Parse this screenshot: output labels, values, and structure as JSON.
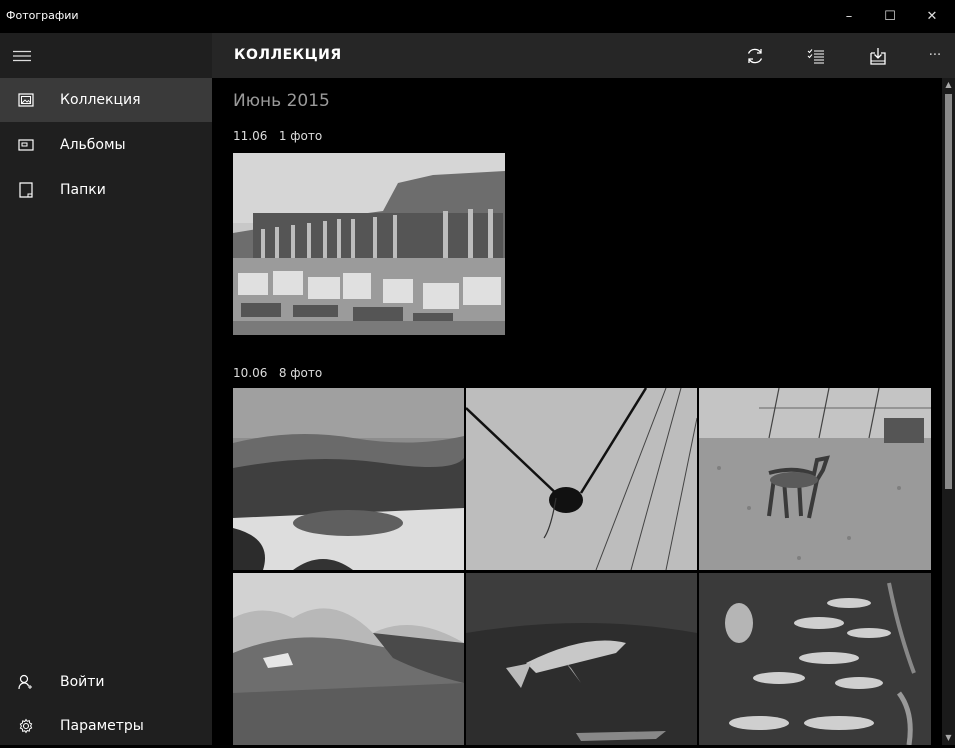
{
  "window": {
    "title": "Фотографии",
    "minimize_glyph": "–",
    "maximize_glyph": "☐",
    "close_glyph": "✕"
  },
  "sidebar": {
    "menu_icon": "hamburger-icon",
    "items": [
      {
        "label": "Коллекция",
        "icon": "collection-icon",
        "selected": true
      },
      {
        "label": "Альбомы",
        "icon": "album-icon",
        "selected": false
      },
      {
        "label": "Папки",
        "icon": "folder-icon",
        "selected": false
      }
    ],
    "bottom_items": [
      {
        "label": "Войти",
        "icon": "person-icon"
      },
      {
        "label": "Параметры",
        "icon": "gear-icon"
      }
    ]
  },
  "header": {
    "title": "КОЛЛЕКЦИЯ",
    "more_glyph": "···",
    "actions": [
      "refresh-icon",
      "select-icon",
      "import-icon",
      "more-icon"
    ]
  },
  "main": {
    "month": "Июнь 2015",
    "groups": [
      {
        "date": "11.06",
        "count": "1 фото"
      },
      {
        "date": "10.06",
        "count": "8 фото"
      }
    ]
  },
  "scrollbar": {
    "up_glyph": "▲",
    "down_glyph": "▼"
  }
}
